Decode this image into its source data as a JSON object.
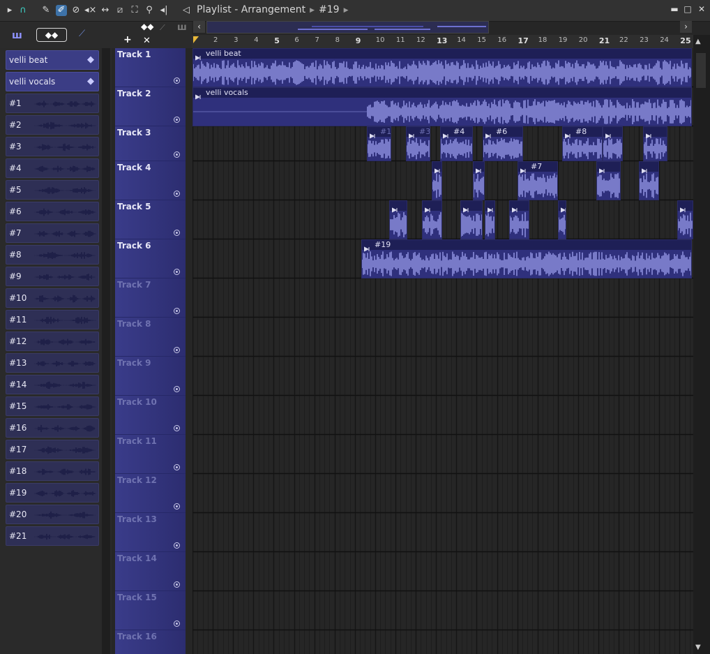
{
  "titlebar": {
    "title": "Playlist - Arrangement",
    "pattern": "#19",
    "minimize": "▬",
    "maximize": "□",
    "close": "✕"
  },
  "toolbar_icons": [
    "play-icon",
    "magnet-icon",
    "pencil-icon",
    "paint-icon",
    "delete-icon",
    "mute-icon",
    "slip-icon",
    "slice-icon",
    "select-icon",
    "zoom-icon",
    "playback-icon",
    "speaker-icon"
  ],
  "picker_tabs": {
    "add": "+",
    "remove": "✕"
  },
  "picker": [
    {
      "label": "velli beat",
      "audio": true
    },
    {
      "label": "velli vocals",
      "audio": true
    },
    {
      "label": "#1"
    },
    {
      "label": "#2"
    },
    {
      "label": "#3"
    },
    {
      "label": "#4"
    },
    {
      "label": "#5"
    },
    {
      "label": "#6"
    },
    {
      "label": "#7"
    },
    {
      "label": "#8"
    },
    {
      "label": "#9"
    },
    {
      "label": "#10"
    },
    {
      "label": "#11"
    },
    {
      "label": "#12"
    },
    {
      "label": "#13"
    },
    {
      "label": "#14"
    },
    {
      "label": "#15"
    },
    {
      "label": "#16"
    },
    {
      "label": "#17"
    },
    {
      "label": "#18"
    },
    {
      "label": "#19"
    },
    {
      "label": "#20"
    },
    {
      "label": "#21"
    }
  ],
  "tracks": [
    "Track 1",
    "Track 2",
    "Track 3",
    "Track 4",
    "Track 5",
    "Track 6",
    "Track 7",
    "Track 8",
    "Track 9",
    "Track 10",
    "Track 11",
    "Track 12",
    "Track 13",
    "Track 14",
    "Track 15",
    "Track 16"
  ],
  "ruler": [
    "2",
    "3",
    "4",
    "5",
    "6",
    "7",
    "8",
    "9",
    "10",
    "11",
    "12",
    "13",
    "14",
    "15",
    "16",
    "17",
    "18",
    "19",
    "20",
    "21",
    "22",
    "23",
    "24",
    "25"
  ],
  "clips": [
    {
      "name": "velli beat",
      "track": 1,
      "start": 1.0,
      "len": 24.6
    },
    {
      "name": "velli vocals",
      "track": 2,
      "start": 1.0,
      "len": 24.6
    },
    {
      "name": "#1",
      "track": 3,
      "start": 9.6,
      "len": 1.2,
      "dim": true
    },
    {
      "name": "#3",
      "track": 3,
      "start": 11.5,
      "len": 1.2,
      "dim": true
    },
    {
      "name": "#4",
      "track": 3,
      "start": 13.2,
      "len": 1.6
    },
    {
      "name": "#6",
      "track": 3,
      "start": 15.3,
      "len": 2.0
    },
    {
      "name": "#8",
      "track": 3,
      "start": 19.2,
      "len": 2.0
    },
    {
      "name": "",
      "track": 3,
      "start": 21.2,
      "len": 1.0
    },
    {
      "name": "",
      "track": 3,
      "start": 23.2,
      "len": 1.2
    },
    {
      "name": "",
      "track": 4,
      "start": 12.8,
      "len": 0.5
    },
    {
      "name": "",
      "track": 4,
      "start": 14.8,
      "len": 0.6
    },
    {
      "name": "#7",
      "track": 4,
      "start": 17.0,
      "len": 2.0
    },
    {
      "name": "",
      "track": 4,
      "start": 20.9,
      "len": 1.2
    },
    {
      "name": "",
      "track": 4,
      "start": 23.0,
      "len": 1.0
    },
    {
      "name": "",
      "track": 5,
      "start": 10.7,
      "len": 0.9
    },
    {
      "name": "",
      "track": 5,
      "start": 12.3,
      "len": 1.0
    },
    {
      "name": "",
      "track": 5,
      "start": 14.2,
      "len": 1.1
    },
    {
      "name": "",
      "track": 5,
      "start": 15.4,
      "len": 0.5
    },
    {
      "name": "",
      "track": 5,
      "start": 16.6,
      "len": 1.0
    },
    {
      "name": "",
      "track": 5,
      "start": 19.0,
      "len": 0.4
    },
    {
      "name": "",
      "track": 5,
      "start": 24.9,
      "len": 0.8
    },
    {
      "name": "#19",
      "track": 6,
      "start": 9.3,
      "len": 16.3
    }
  ],
  "colors": {
    "clip": "#2f307c",
    "wave": "#8a8ddb",
    "track": "#34357a"
  }
}
